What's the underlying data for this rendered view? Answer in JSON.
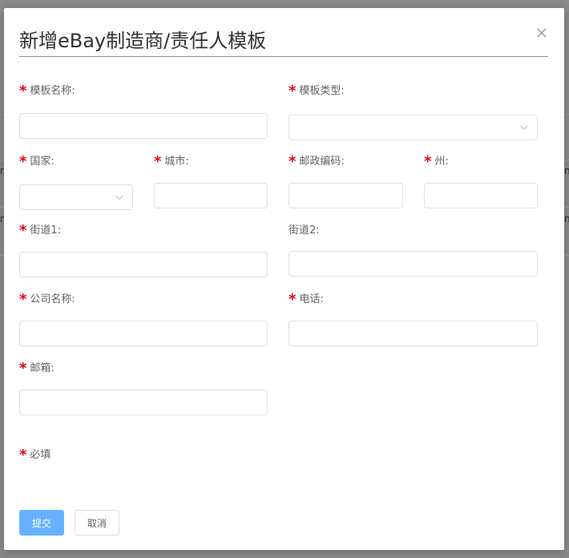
{
  "dialog": {
    "title": "新增eBay制造商/责任人模板",
    "required_mark": "*"
  },
  "fields": {
    "template_name": {
      "label": "模板名称:",
      "value": ""
    },
    "template_type": {
      "label": "模板类型:",
      "value": ""
    },
    "country": {
      "label": "国家:",
      "value": ""
    },
    "city": {
      "label": "城市:",
      "value": ""
    },
    "postal_code": {
      "label": "邮政编码:",
      "value": ""
    },
    "state": {
      "label": "州:",
      "value": ""
    },
    "street1": {
      "label": "街道1:",
      "value": ""
    },
    "street2": {
      "label": "街道2:",
      "value": ""
    },
    "company_name": {
      "label": "公司名称:",
      "value": ""
    },
    "phone": {
      "label": "电话:",
      "value": ""
    },
    "email": {
      "label": "邮箱:",
      "value": ""
    }
  },
  "legend": {
    "required_note": "必填"
  },
  "actions": {
    "submit": "提交",
    "cancel": "取消"
  },
  "background": {
    "glyph": "n"
  },
  "colors": {
    "primary": "#66b1ff",
    "required": "#e0000f",
    "border": "#dcdfe6"
  },
  "icons": {
    "close": "close-icon",
    "select": "chevron-down-icon"
  }
}
